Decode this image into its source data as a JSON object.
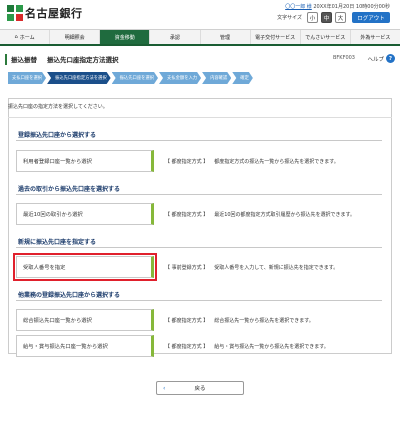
{
  "header": {
    "bank_name": "名古屋銀行",
    "user_name": "〇〇一郎 様",
    "last_login": "20XX年01月20日 10時00分00秒",
    "font_size_label": "文字サイズ",
    "font_sizes": [
      "小",
      "中",
      "大"
    ],
    "logout_label": "ログアウト"
  },
  "nav": {
    "items": [
      {
        "label": "ホーム",
        "icon": "home-icon"
      },
      {
        "label": "明細照会"
      },
      {
        "label": "資金移動"
      },
      {
        "label": "承認"
      },
      {
        "label": "管理"
      },
      {
        "label": "電子交付サービス"
      },
      {
        "label": "でんさいサービス"
      },
      {
        "label": "外為サービス"
      }
    ],
    "active_index": 2
  },
  "title": {
    "main": "振込振替",
    "sub": "振込先口座指定方法選択",
    "screen_id": "BFKF003",
    "help": "ヘルプ"
  },
  "steps": [
    "支払口座を選択",
    "振込先口座指定方法を選択",
    "振込先口座を選択",
    "支払金額を入力",
    "内容確認",
    "確定"
  ],
  "steps_current_index": 1,
  "intro": "振込先口座の指定方法を選択してください。",
  "sections": [
    {
      "title": "登録振込先口座から選択する",
      "choices": [
        {
          "label": "利用者登録口座一覧から選択",
          "kind": "【 都度指定方式 】",
          "desc": "都度指定方式の振込先一覧から振込先を選択できます。"
        }
      ]
    },
    {
      "title": "過去の取引から振込先口座を選択する",
      "choices": [
        {
          "label": "最近10回の取引から選択",
          "kind": "【 都度指定方式 】",
          "desc": "最近10回の都度指定方式取引履歴から振込先を選択できます。"
        }
      ]
    },
    {
      "title": "新規に振込先口座を指定する",
      "choices": [
        {
          "label": "受取人番号を指定",
          "kind": "【 事前登録方式 】",
          "desc": "受取人番号を入力して、新規に振込先を指定できます。"
        }
      ]
    },
    {
      "title": "他業務の登録振込先口座から選択する",
      "choices": [
        {
          "label": "総合振込先口座一覧から選択",
          "kind": "【 都度指定方式 】",
          "desc": "総合振込先一覧から振込先を選択できます。"
        },
        {
          "label": "給与・賞与振込先口座一覧から選択",
          "kind": "【 都度指定方式 】",
          "desc": "給与・賞与振込先一覧から振込先を選択できます。"
        }
      ]
    }
  ],
  "back_label": "戻る"
}
